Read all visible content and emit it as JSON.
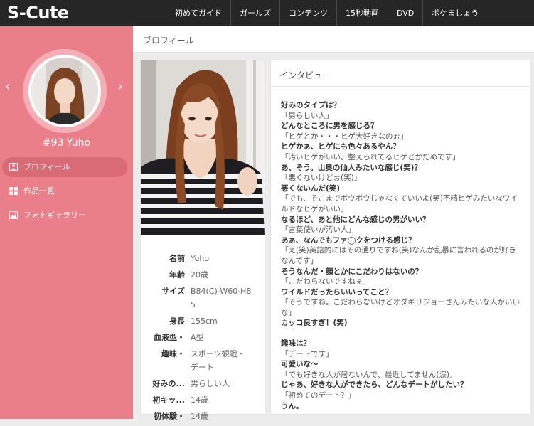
{
  "header": {
    "logo": "S-Cute",
    "nav": [
      "初めてガイド",
      "ガールズ",
      "コンテンツ",
      "15秒動画",
      "DVD",
      "ポケましょう"
    ]
  },
  "sidebar": {
    "prev_arrow": "‹",
    "next_arrow": "›",
    "name": "#93 Yuho",
    "menu": [
      {
        "label": "プロフィール",
        "icon": "profile-icon",
        "active": true
      },
      {
        "label": "作品一覧",
        "icon": "grid-icon",
        "active": false
      },
      {
        "label": "フォトギャラリー",
        "icon": "photo-icon",
        "active": false
      }
    ]
  },
  "main": {
    "title": "プロフィール"
  },
  "profile": {
    "rows": [
      {
        "label": "名前",
        "value": "Yuho"
      },
      {
        "label": "年齢",
        "value": "20歳"
      },
      {
        "label": "サイズ",
        "value": "B84(C)-W60-H85"
      },
      {
        "label": "身長",
        "value": "155cm"
      },
      {
        "label": "血液型・",
        "value": "A型"
      },
      {
        "label": "趣味・",
        "value": "スポーツ観戦・デート"
      },
      {
        "label": "好みの...",
        "value": "男らしい人"
      },
      {
        "label": "初キッ...",
        "value": "14歳"
      },
      {
        "label": "初体験・",
        "value": "14歳"
      }
    ]
  },
  "interview": {
    "title": "インタビュー",
    "lines": [
      {
        "t": "q",
        "text": "好みのタイプは？"
      },
      {
        "t": "a",
        "text": "「男らしい人」"
      },
      {
        "t": "q",
        "text": "どんなところに男を感じる？"
      },
      {
        "t": "a",
        "text": "「ヒゲとか・・・ヒゲ大好きなのぉ」"
      },
      {
        "t": "q",
        "text": "ヒゲかぁ、ヒゲにも色々あるやん？"
      },
      {
        "t": "a",
        "text": "「汚いヒゲがいい。整えられてるヒゲとかだめです」"
      },
      {
        "t": "q",
        "text": "あ、そう。山奥の仙人みたいな感じ(笑)？"
      },
      {
        "t": "a",
        "text": "「悪くないけどぉ(笑)」"
      },
      {
        "t": "q",
        "text": "悪くないんだ(笑)"
      },
      {
        "t": "a",
        "text": "「でも、そこまでボウボウじゃなくていいよ(笑)不精ヒゲみたいなワイルドなヒゲがいい」"
      },
      {
        "t": "q",
        "text": "なるほど、あと他にどんな感じの男がいい？"
      },
      {
        "t": "a",
        "text": "「言葉使いが汚い人」"
      },
      {
        "t": "q",
        "text": "あぁ、なんでもファ◯クをつける感じ？"
      },
      {
        "t": "a",
        "text": "「え(笑)英語的にはその通りですね(笑)なんか乱暴に言われるのが好きなんです」"
      },
      {
        "t": "q",
        "text": "そうなんだ・顔とかにこだわりはないの？"
      },
      {
        "t": "a",
        "text": "「こだわらないですねぇ」"
      },
      {
        "t": "q",
        "text": "ワイルドだったらいいってこと？"
      },
      {
        "t": "a",
        "text": "「そうですね。こだわらないけどオダギリジョーさんみたいな人がいいな」"
      },
      {
        "t": "q",
        "text": "カッコ良すぎ！(笑)"
      },
      {
        "t": "gap",
        "text": ""
      },
      {
        "t": "q",
        "text": "趣味は？"
      },
      {
        "t": "a",
        "text": "「デートです」"
      },
      {
        "t": "q",
        "text": "可愛いな〜"
      },
      {
        "t": "a",
        "text": "「でも好きな人が居ないんで、最近してません(涙)」"
      },
      {
        "t": "q",
        "text": "じゃあ、好きな人ができたら、どんなデートがしたい？"
      },
      {
        "t": "a",
        "text": "「初めてのデート？」"
      },
      {
        "t": "q",
        "text": "うん。"
      }
    ]
  },
  "colors": {
    "sidebar": "#ea7f8a",
    "topbar": "#262626",
    "active_item": "#d96b77"
  }
}
